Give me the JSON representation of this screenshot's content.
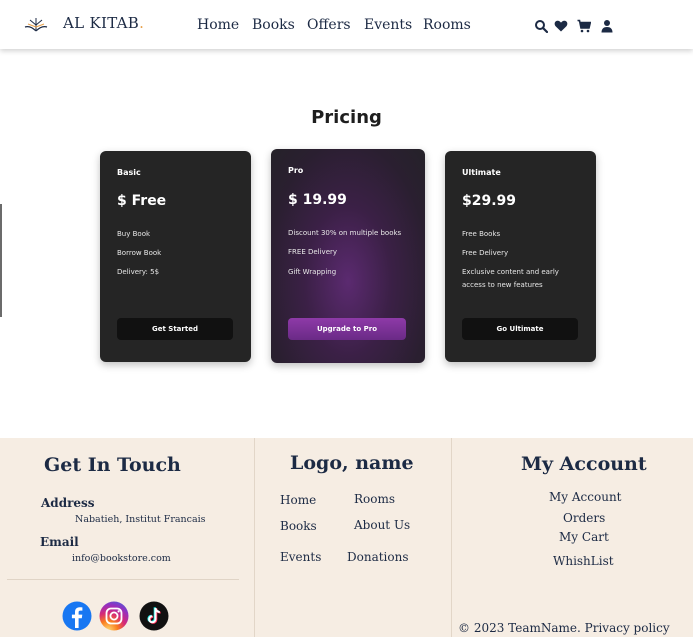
{
  "header": {
    "brand": "AL KITAB",
    "brand_dot": ".",
    "nav": [
      "Home",
      "Books",
      "Offers",
      "Events",
      "Rooms"
    ],
    "icons": [
      "search-icon",
      "heart-icon",
      "cart-icon",
      "user-icon"
    ]
  },
  "pricing": {
    "title": "Pricing",
    "plans": [
      {
        "name": "Basic",
        "price": "$ Free",
        "features": [
          "Buy Book",
          "Borrow Book",
          "Delivery: 5$"
        ],
        "button": "Get Started"
      },
      {
        "name": "Pro",
        "price": "$ 19.99",
        "features": [
          "Discount 30% on multiple books",
          "FREE Delivery",
          "Gift Wrapping"
        ],
        "button": "Upgrade to Pro"
      },
      {
        "name": "Ultimate",
        "price": "$29.99",
        "features": [
          "Free Books",
          "Free Delivery",
          "Exclusive content and early access to new features"
        ],
        "button": "Go Ultimate"
      }
    ]
  },
  "footer": {
    "contact": {
      "title": "Get In Touch",
      "address_label": "Address",
      "address_value": "Nabatieh, Institut Francais",
      "email_label": "Email",
      "email_value": "info@bookstore.com"
    },
    "middle": {
      "title": "Logo, name",
      "links": [
        "Home",
        "Rooms",
        "Books",
        "About Us",
        "Events",
        "Donations"
      ]
    },
    "account": {
      "title": "My Account",
      "links": [
        "My Account",
        "Orders",
        "My Cart",
        "WhishList"
      ]
    },
    "copyright": "© 2023 TeamName. Privacy policy",
    "social": [
      "facebook-icon",
      "instagram-icon",
      "tiktok-icon"
    ]
  },
  "colors": {
    "navy": "#1c2a44",
    "accent": "#e8a14a",
    "footer_bg": "#f6ede3",
    "card_bg": "#252525",
    "pro_button": "#7a3196"
  }
}
